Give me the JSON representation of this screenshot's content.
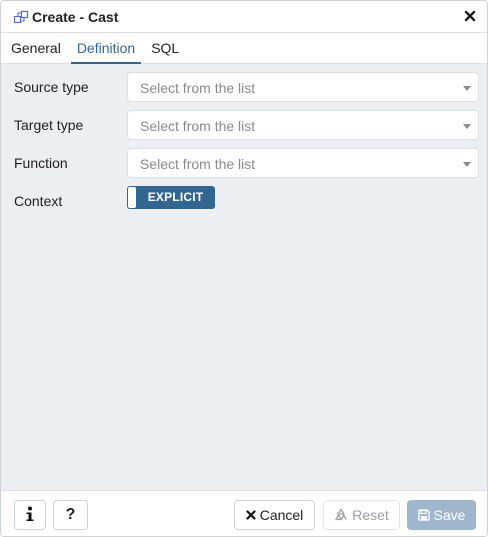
{
  "dialog": {
    "title": "Create - Cast",
    "title_icon": "cast-icon",
    "close_icon": "close-icon"
  },
  "tabs": [
    {
      "label": "General",
      "active": false
    },
    {
      "label": "Definition",
      "active": true
    },
    {
      "label": "SQL",
      "active": false
    }
  ],
  "form": {
    "source_type": {
      "label": "Source type",
      "placeholder": "Select from the list"
    },
    "target_type": {
      "label": "Target type",
      "placeholder": "Select from the list"
    },
    "function": {
      "label": "Function",
      "placeholder": "Select from the list"
    },
    "context": {
      "label": "Context",
      "value": "EXPLICIT"
    }
  },
  "footer": {
    "info_icon": "info-icon",
    "help_label": "?",
    "cancel_label": "Cancel",
    "reset_label": "Reset",
    "save_label": "Save"
  },
  "colors": {
    "accent": "#326690",
    "body_bg": "#ebeef3",
    "save_disabled": "#9fb6cc"
  }
}
